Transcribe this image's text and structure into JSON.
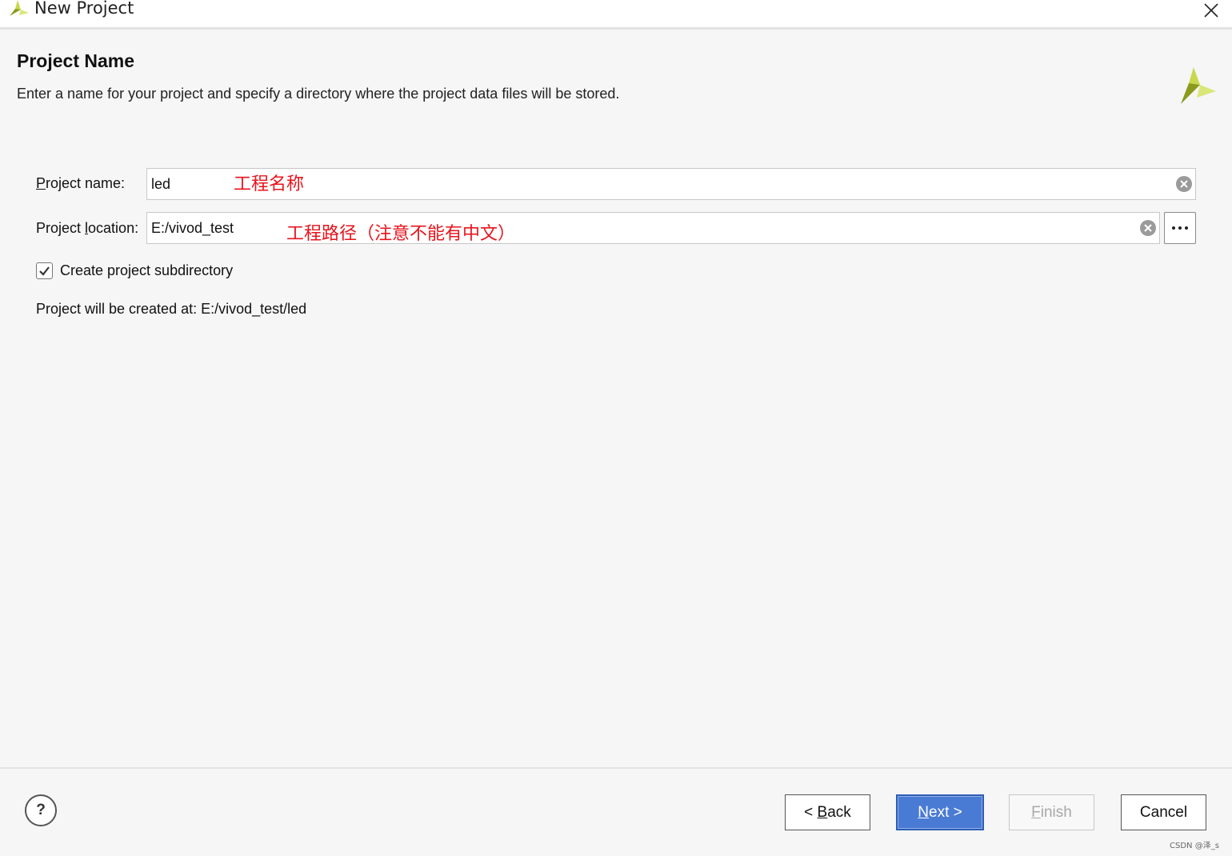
{
  "window": {
    "title": "New Project",
    "close_icon": "close-icon"
  },
  "page": {
    "heading": "Project Name",
    "description": "Enter a name for your project and specify a directory where the project data files will be stored."
  },
  "form": {
    "project_name": {
      "label_mnemonic": "P",
      "label_rest": "roject name:",
      "value": "led",
      "annotation": "工程名称"
    },
    "project_location": {
      "label_pre": "Project ",
      "label_mnemonic": "l",
      "label_rest": "ocation:",
      "value": "E:/vivod_test",
      "annotation": "工程路径（注意不能有中文）",
      "browse_icon": "ellipsis-icon"
    },
    "create_subdirectory": {
      "label": "Create project subdirectory",
      "checked": true
    },
    "created_at": "Project will be created at: E:/vivod_test/led"
  },
  "footer": {
    "help_label": "?",
    "back": {
      "prefix": "< ",
      "mnemonic": "B",
      "rest": "ack"
    },
    "next": {
      "mnemonic": "N",
      "rest": "ext >"
    },
    "finish": {
      "mnemonic": "F",
      "rest": "inish"
    },
    "cancel": "Cancel"
  },
  "watermark": "CSDN @泽_s",
  "colors": {
    "accent": "#4a7bd4",
    "annotation": "#e8131c",
    "logo_dark": "#8a9a1c",
    "logo_light": "#c8d84a"
  }
}
